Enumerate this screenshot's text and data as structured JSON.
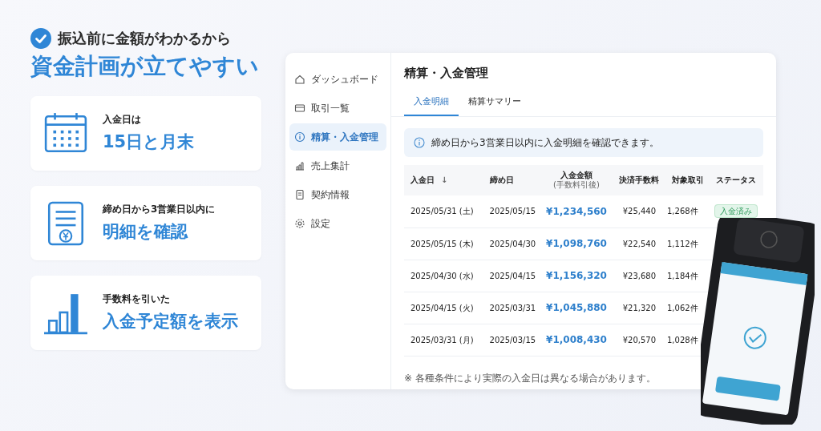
{
  "headline": {
    "lead": "振込前に金額がわかるから",
    "title": "資金計画が立てやすい"
  },
  "features": [
    {
      "caption": "入金日は",
      "value": "15日と月末"
    },
    {
      "caption": "締め日から3営業日以内に",
      "value": "明細を確認"
    },
    {
      "caption": "手数料を引いた",
      "value": "入金予定額を表示"
    }
  ],
  "app": {
    "sidebar": {
      "items": [
        {
          "label": "ダッシュボード",
          "selected": false
        },
        {
          "label": "取引一覧",
          "selected": false
        },
        {
          "label": "精算・入金管理",
          "selected": true
        },
        {
          "label": "売上集計",
          "selected": false
        },
        {
          "label": "契約情報",
          "selected": false
        },
        {
          "label": "設定",
          "selected": false
        }
      ]
    },
    "page_title": "精算・入金管理",
    "tabs": [
      {
        "label": "入金明細",
        "selected": true
      },
      {
        "label": "精算サマリー",
        "selected": false
      }
    ],
    "info": "締め日から3営業日以内に入金明細を確認できます。",
    "table": {
      "columns": [
        {
          "label": "入金日",
          "sort": "↓"
        },
        {
          "label": "締め日"
        },
        {
          "label": "入金金額",
          "sub": "(手数料引後)"
        },
        {
          "label": "決済手数料"
        },
        {
          "label": "対象取引"
        },
        {
          "label": "ステータス"
        }
      ],
      "rows": [
        {
          "date": "2025/05/31 (土)",
          "closing": "2025/05/15",
          "amount": "¥1,234,560",
          "fee": "¥25,440",
          "count": "1,268件",
          "status": "入金済み"
        },
        {
          "date": "2025/05/15 (木)",
          "closing": "2025/04/30",
          "amount": "¥1,098,760",
          "fee": "¥22,540",
          "count": "1,112件"
        },
        {
          "date": "2025/04/30 (水)",
          "closing": "2025/04/15",
          "amount": "¥1,156,320",
          "fee": "¥23,680",
          "count": "1,184件"
        },
        {
          "date": "2025/04/15 (火)",
          "closing": "2025/03/31",
          "amount": "¥1,045,880",
          "fee": "¥21,320",
          "count": "1,062件"
        },
        {
          "date": "2025/03/31 (月)",
          "closing": "2025/03/15",
          "amount": "¥1,008,430",
          "fee": "¥20,570",
          "count": "1,028件"
        }
      ]
    },
    "footnote": "※ 各種条件により実際の入金日は異なる場合があります。"
  }
}
